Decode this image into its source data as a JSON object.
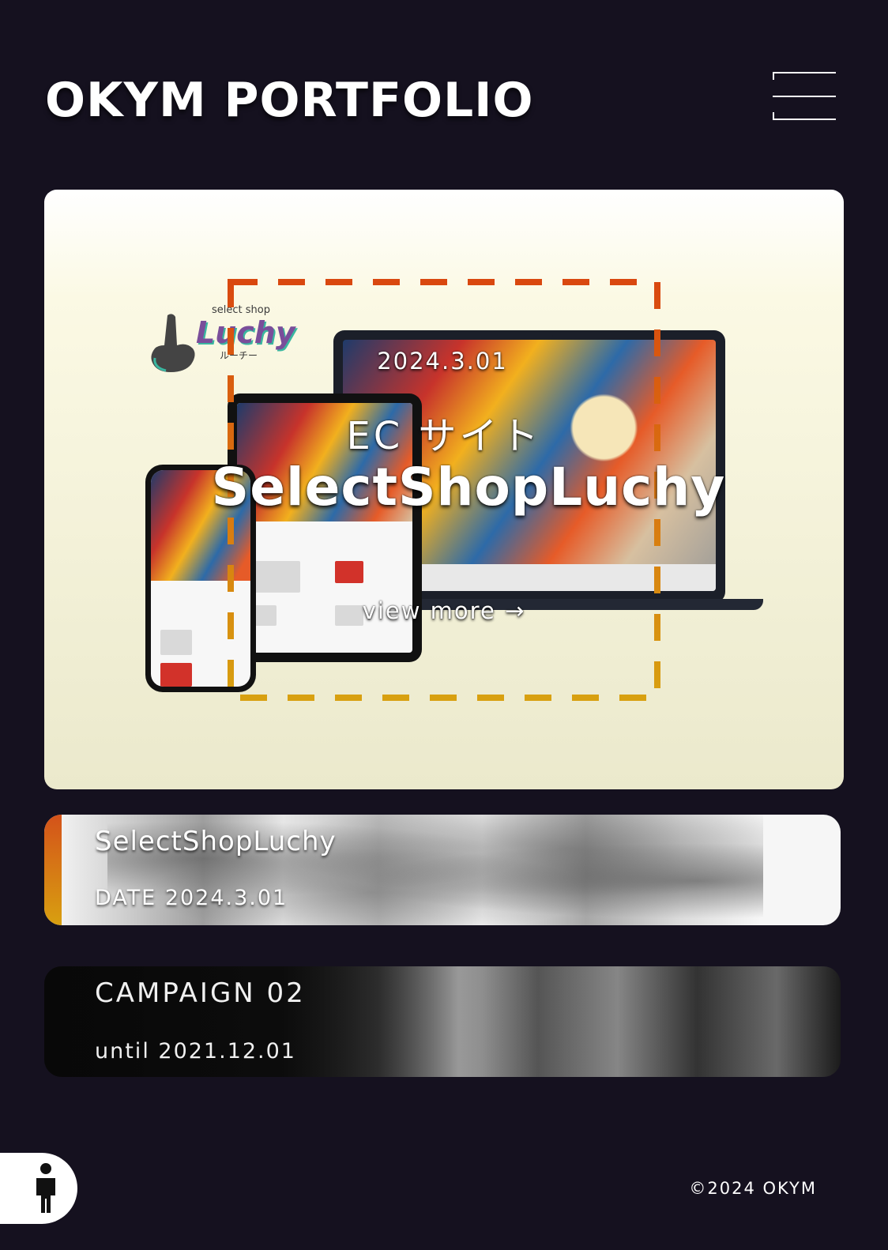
{
  "header": {
    "site_title": "OKYM PORTFOLIO",
    "menu_icon": "hamburger-menu-icon"
  },
  "hero": {
    "date": "2024.3.01",
    "category": "EC サイト",
    "title": "SelectShopLuchy",
    "view_more": "view more →",
    "brand": {
      "small": "select shop",
      "name": "Luchy",
      "kana": "ルーチー"
    },
    "dash_color_start": "#d9480f",
    "dash_color_end": "#d8a010"
  },
  "cards": [
    {
      "title": "SelectShopLuchy",
      "subtitle": "DATE 2024.3.01"
    },
    {
      "title": "CAMPAIGN 02",
      "subtitle": "until   2021.12.01"
    }
  ],
  "footer": {
    "copyright": "©2024 OKYM",
    "accessibility_icon": "accessibility-person-icon"
  }
}
